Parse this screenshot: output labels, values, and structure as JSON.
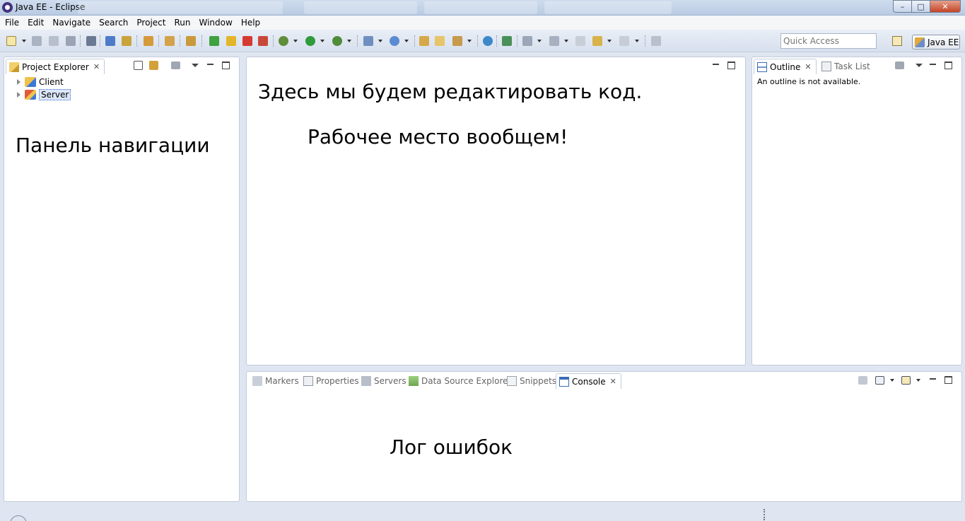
{
  "window": {
    "title": "Java EE - Eclipse",
    "min": "–",
    "max": "□",
    "close": "✕"
  },
  "menu": [
    "File",
    "Edit",
    "Navigate",
    "Search",
    "Project",
    "Run",
    "Window",
    "Help"
  ],
  "toolbar": {
    "quick_access_placeholder": "Quick Access",
    "perspective": "Java EE"
  },
  "project_explorer": {
    "tab": "Project Explorer",
    "items": [
      "Client",
      "Server"
    ]
  },
  "outline": {
    "tab_outline": "Outline",
    "tab_task_list": "Task List",
    "message": "An outline is not available."
  },
  "bottom_tabs": {
    "markers": "Markers",
    "properties": "Properties",
    "servers": "Servers",
    "data_source_explorer": "Data Source Explorer",
    "snippets": "Snippets",
    "console": "Console"
  },
  "annotations": {
    "navigation": "Панель навигации",
    "editor_line1": "Здесь мы будем редактировать код.",
    "editor_line2": "Рабочее место вообщем!",
    "log": "Лог ошибок"
  },
  "colors": {
    "background": "#dfe6f2",
    "panel_border": "#c2cbdb",
    "selection": "#dce7f9"
  }
}
